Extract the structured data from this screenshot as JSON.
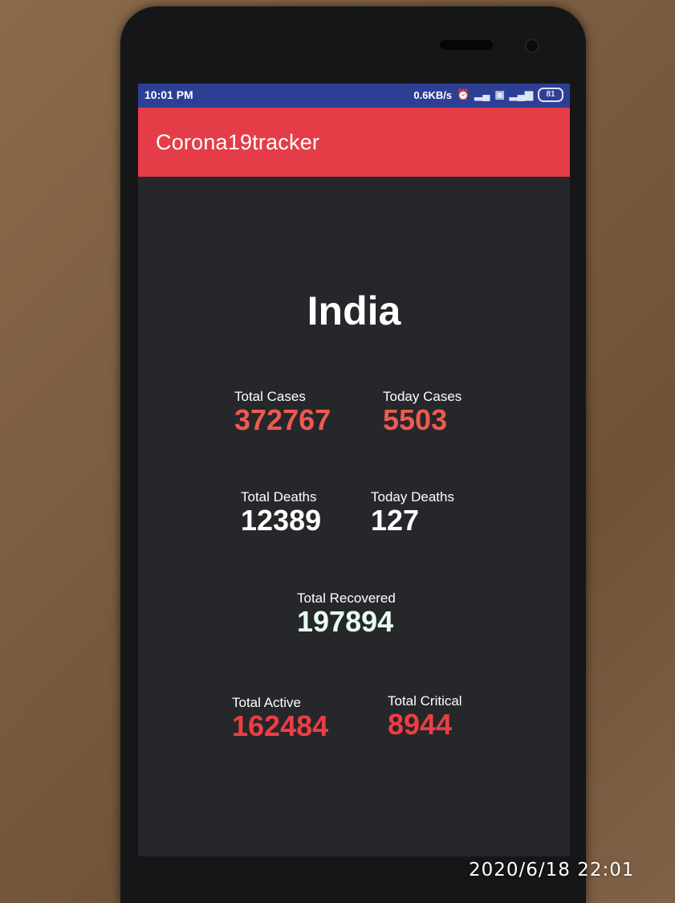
{
  "status_bar": {
    "time": "10:01 PM",
    "network_speed": "0.6KB/s",
    "battery": "81",
    "icons": [
      "mute-alarm-icon",
      "signal-icon",
      "sim-icon",
      "4g-signal-icon",
      "battery-icon"
    ]
  },
  "app_bar": {
    "title": "Corona19tracker",
    "color": "#e53d47"
  },
  "country": "India",
  "stats": {
    "total_cases": {
      "label": "Total Cases",
      "value": "372767"
    },
    "today_cases": {
      "label": "Today Cases",
      "value": "5503"
    },
    "total_deaths": {
      "label": "Total Deaths",
      "value": "12389"
    },
    "today_deaths": {
      "label": "Today Deaths",
      "value": "127"
    },
    "total_recovered": {
      "label": "Total Recovered",
      "value": "197894"
    },
    "total_active": {
      "label": "Total Active",
      "value": "162484"
    },
    "total_critical": {
      "label": "Total Critical",
      "value": "8944"
    }
  },
  "colors": {
    "status_bar": "#2d3f94",
    "background": "#26272a",
    "cases": "#ee5a4f",
    "critical": "#ee3d44"
  },
  "photo_timestamp": "2020/6/18 22:01"
}
